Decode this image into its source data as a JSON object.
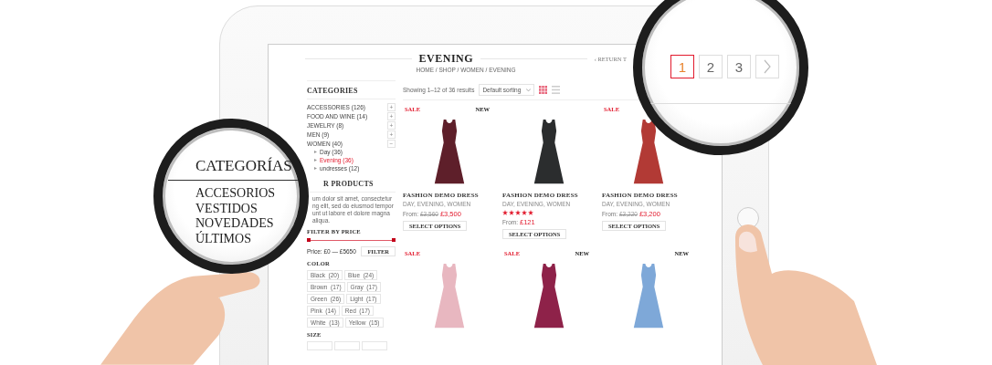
{
  "page": {
    "title": "EVENING",
    "breadcrumb": "HOME / SHOP / WOMEN / EVENING",
    "return_link": "‹ RETURN T"
  },
  "sidebar": {
    "categories_title": "CATEGORIES",
    "categories": [
      {
        "label": "ACCESSORIES (126)",
        "toggle": "+",
        "selected": false
      },
      {
        "label": "FOOD AND WINE (14)",
        "toggle": "+",
        "selected": false
      },
      {
        "label": "JEWELRY (8)",
        "toggle": "+",
        "selected": false
      },
      {
        "label": "MEN (9)",
        "toggle": "+",
        "selected": false
      },
      {
        "label": "WOMEN (40)",
        "toggle": "−",
        "selected": false,
        "children": [
          {
            "label": "Day (36)",
            "selected": false
          },
          {
            "label": "Evening (36)",
            "selected": true
          },
          {
            "label": "undresses (12)",
            "selected": false
          }
        ]
      }
    ],
    "products_title": "R PRODUCTS",
    "products_text": [
      "um dolor sit amet, consectetur",
      "ng elit, sed do eiusmod tempor",
      "unt ut labore et dolore magna aliqua."
    ],
    "price_title": "FILTER BY PRICE",
    "price_slider": {
      "level": 1
    },
    "price_label": "Price: £0 — £5650",
    "filter_button": "FILTER",
    "color_title": "COLOR",
    "colors": [
      "Black  (20)",
      "Blue  (24)",
      "Brown  (17)",
      "Gray  (17)",
      "Green  (26)",
      "Light  (17)",
      "Pink  (14)",
      "Red  (17)",
      "White  (13)",
      "Yellow  (15)"
    ],
    "size_title": "SIZE"
  },
  "toolbar": {
    "results": "Showing 1–12 of 36 results",
    "sorting": "Default sorting"
  },
  "products": [
    {
      "badges": [
        {
          "kind": "sale",
          "text": "SALE"
        },
        {
          "kind": "new",
          "text": "NEW"
        }
      ],
      "color": "#5e1f2a",
      "title": "FASHION DEMO DRESS",
      "categories": "DAY, EVENING, WOMEN",
      "from": "From:",
      "old_price": "£3,560",
      "price": "£3,500",
      "button": "SELECT OPTIONS"
    },
    {
      "color": "#2b2d2e",
      "title": "FASHION DEMO DRESS",
      "categories": "DAY, EVENING, WOMEN",
      "stars": 5,
      "from": "From:",
      "price": "£121",
      "button": "SELECT OPTIONS"
    },
    {
      "badges": [
        {
          "kind": "sale",
          "text": "SALE"
        }
      ],
      "color": "#b23a35",
      "title": "FASHION DEMO DRESS",
      "categories": "DAY, EVENING, WOMEN",
      "from": "From:",
      "old_price": "£3,220",
      "price": "£3,200",
      "button": "SELECT OPTIONS"
    },
    {
      "badges": [
        {
          "kind": "sale",
          "text": "SALE"
        }
      ],
      "color": "#e8b7c0"
    },
    {
      "badges": [
        {
          "kind": "sale",
          "text": "SALE"
        },
        {
          "kind": "new",
          "text": "NEW"
        }
      ],
      "color": "#8e2249"
    },
    {
      "badges": [
        {
          "kind": "new",
          "text": "NEW"
        }
      ],
      "color": "#7ea8d8"
    }
  ],
  "magnifier_categories": {
    "title": "CATEGORÍAS",
    "items": [
      "ACCESORIOS",
      "VESTIDOS",
      "NOVEDADES",
      "ÚLTIMOS"
    ]
  },
  "pagination": {
    "pages": [
      {
        "label": "1",
        "selected": true
      },
      {
        "label": "2",
        "selected": false
      },
      {
        "label": "3",
        "selected": false
      }
    ]
  }
}
